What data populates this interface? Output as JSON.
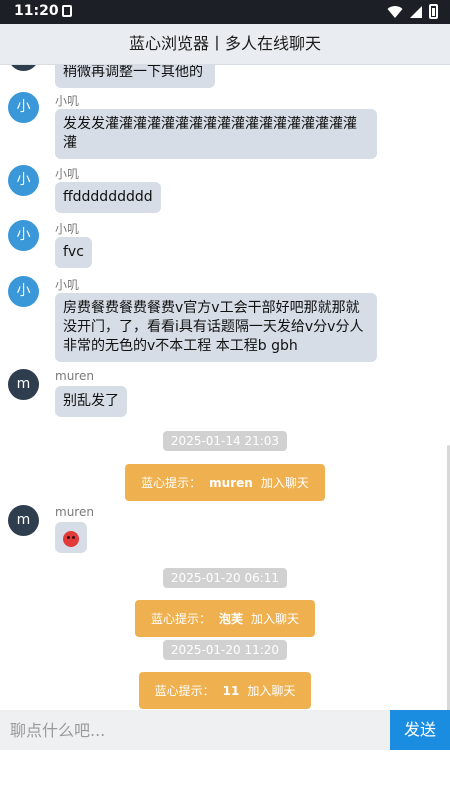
{
  "status": {
    "time": "11:20"
  },
  "title": "蓝心浏览器丨多人在线聊天",
  "messages": [
    {
      "kind": "msg",
      "avatar": "",
      "sender": "",
      "text": "稍微再调整一下其他的",
      "avatar_color": "#2f3e4f"
    },
    {
      "kind": "msg",
      "avatar": "小",
      "sender": "小叽",
      "text": "发发发灌灌灌灌灌灌灌灌灌灌灌灌灌灌灌灌灌灌灌"
    },
    {
      "kind": "msg",
      "avatar": "小",
      "sender": "小叽",
      "text": "ffddddddddd"
    },
    {
      "kind": "msg",
      "avatar": "小",
      "sender": "小叽",
      "text": "fvc"
    },
    {
      "kind": "msg",
      "avatar": "小",
      "sender": "小叽",
      "text": "房费餐费餐费餐费v官方v工会干部好吧那就那就没开门，了，看看i具有话题隔一天发给v分v分人非常的无色的v不本工程 本工程b gbh"
    },
    {
      "kind": "msg",
      "avatar": "m",
      "sender": "muren",
      "text": "别乱发了"
    },
    {
      "kind": "time",
      "text": "2025-01-14 21:03"
    },
    {
      "kind": "system",
      "prefix": "蓝心提示：",
      "name": "muren",
      "suffix": "加入聊天"
    },
    {
      "kind": "msg",
      "avatar": "m",
      "sender": "muren",
      "text": "",
      "emoji": "angry-face"
    },
    {
      "kind": "time",
      "text": "2025-01-20 06:11"
    },
    {
      "kind": "system",
      "prefix": "蓝心提示：",
      "name": "泡芙",
      "suffix": "加入聊天"
    },
    {
      "kind": "time",
      "text": "2025-01-20 11:20"
    },
    {
      "kind": "system",
      "prefix": "蓝心提示：",
      "name": "11",
      "suffix": "加入聊天"
    }
  ],
  "input": {
    "placeholder": "聊点什么吧..."
  },
  "send_label": "发送",
  "colors": {
    "bubble": "#d6dde6",
    "system": "#efb04f",
    "send": "#1b8de1",
    "avatar_blue": "#3a97d8",
    "avatar_dark": "#2f3e4f"
  }
}
